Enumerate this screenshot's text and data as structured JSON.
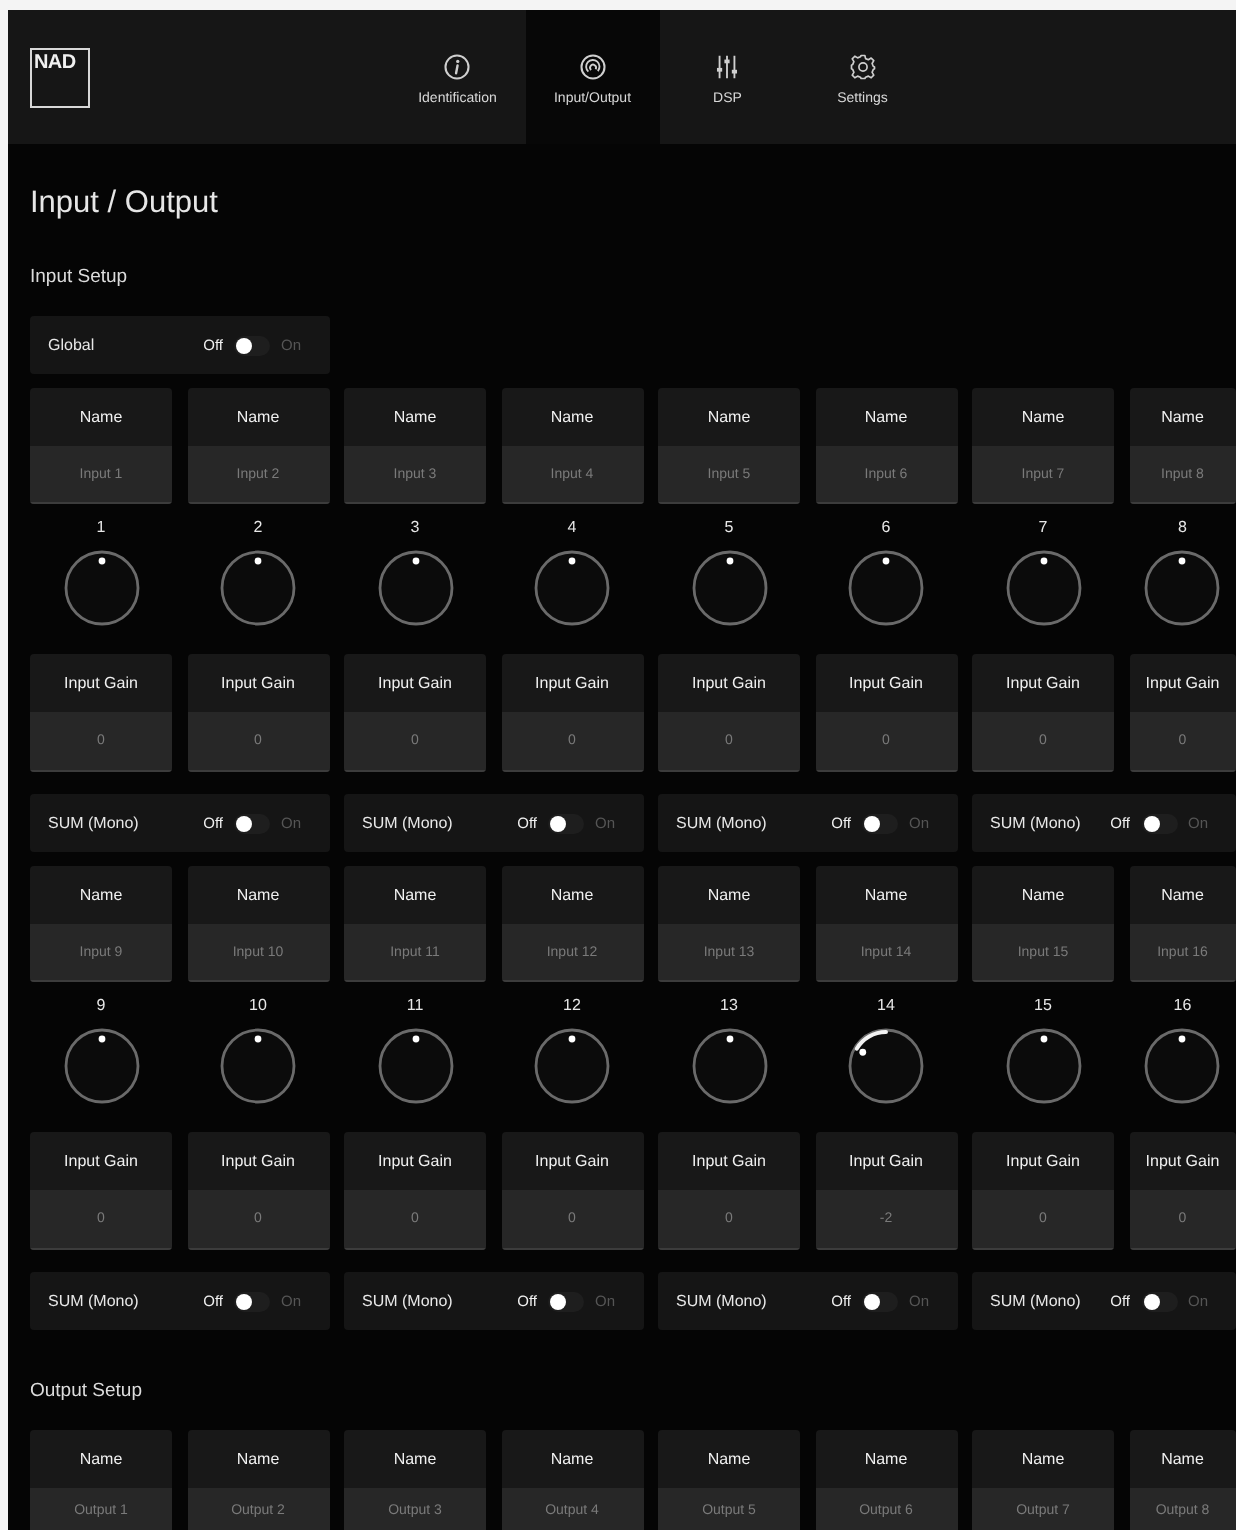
{
  "header": {
    "logo": "NAD",
    "tabs": [
      {
        "label": "Identification",
        "selected": false
      },
      {
        "label": "Input/Output",
        "selected": true
      },
      {
        "label": "DSP",
        "selected": false
      },
      {
        "label": "Settings",
        "selected": false
      }
    ]
  },
  "page": {
    "title": "Input / Output"
  },
  "input_setup": {
    "heading": "Input Setup",
    "global": {
      "label": "Global",
      "off_label": "Off",
      "on_label": "On",
      "on": false
    },
    "blocks": [
      {
        "channels": [
          {
            "name_label": "Name",
            "name_value": "Input 1",
            "number": "1",
            "level": 0.5,
            "gain_label": "Input Gain",
            "gain_value": "0"
          },
          {
            "name_label": "Name",
            "name_value": "Input 2",
            "number": "2",
            "level": 0.5,
            "gain_label": "Input Gain",
            "gain_value": "0"
          },
          {
            "name_label": "Name",
            "name_value": "Input 3",
            "number": "3",
            "level": 0.5,
            "gain_label": "Input Gain",
            "gain_value": "0"
          },
          {
            "name_label": "Name",
            "name_value": "Input 4",
            "number": "4",
            "level": 0.5,
            "gain_label": "Input Gain",
            "gain_value": "0"
          },
          {
            "name_label": "Name",
            "name_value": "Input 5",
            "number": "5",
            "level": 0.5,
            "gain_label": "Input Gain",
            "gain_value": "0"
          },
          {
            "name_label": "Name",
            "name_value": "Input 6",
            "number": "6",
            "level": 0.5,
            "gain_label": "Input Gain",
            "gain_value": "0"
          },
          {
            "name_label": "Name",
            "name_value": "Input 7",
            "number": "7",
            "level": 0.5,
            "gain_label": "Input Gain",
            "gain_value": "0"
          },
          {
            "name_label": "Name",
            "name_value": "Input 8",
            "number": "8",
            "level": 0.5,
            "gain_label": "Input Gain",
            "gain_value": "0"
          }
        ],
        "sums": [
          {
            "label": "SUM (Mono)",
            "off_label": "Off",
            "on_label": "On",
            "on": false
          },
          {
            "label": "SUM (Mono)",
            "off_label": "Off",
            "on_label": "On",
            "on": false
          },
          {
            "label": "SUM (Mono)",
            "off_label": "Off",
            "on_label": "On",
            "on": false
          },
          {
            "label": "SUM (Mono)",
            "off_label": "Off",
            "on_label": "On",
            "on": false
          }
        ]
      },
      {
        "channels": [
          {
            "name_label": "Name",
            "name_value": "Input 9",
            "number": "9",
            "level": 0.5,
            "gain_label": "Input Gain",
            "gain_value": "0"
          },
          {
            "name_label": "Name",
            "name_value": "Input 10",
            "number": "10",
            "level": 0.5,
            "gain_label": "Input Gain",
            "gain_value": "0"
          },
          {
            "name_label": "Name",
            "name_value": "Input 11",
            "number": "11",
            "level": 0.5,
            "gain_label": "Input Gain",
            "gain_value": "0"
          },
          {
            "name_label": "Name",
            "name_value": "Input 12",
            "number": "12",
            "level": 0.5,
            "gain_label": "Input Gain",
            "gain_value": "0"
          },
          {
            "name_label": "Name",
            "name_value": "Input 13",
            "number": "13",
            "level": 0.5,
            "gain_label": "Input Gain",
            "gain_value": "0"
          },
          {
            "name_label": "Name",
            "name_value": "Input 14",
            "number": "14",
            "level": 0.28,
            "gain_label": "Input Gain",
            "gain_value": "-2"
          },
          {
            "name_label": "Name",
            "name_value": "Input 15",
            "number": "15",
            "level": 0.5,
            "gain_label": "Input Gain",
            "gain_value": "0"
          },
          {
            "name_label": "Name",
            "name_value": "Input 16",
            "number": "16",
            "level": 0.5,
            "gain_label": "Input Gain",
            "gain_value": "0"
          }
        ],
        "sums": [
          {
            "label": "SUM (Mono)",
            "off_label": "Off",
            "on_label": "On",
            "on": false
          },
          {
            "label": "SUM (Mono)",
            "off_label": "Off",
            "on_label": "On",
            "on": false
          },
          {
            "label": "SUM (Mono)",
            "off_label": "Off",
            "on_label": "On",
            "on": false
          },
          {
            "label": "SUM (Mono)",
            "off_label": "Off",
            "on_label": "On",
            "on": false
          }
        ]
      }
    ]
  },
  "output_setup": {
    "heading": "Output Setup",
    "channels": [
      {
        "name_label": "Name",
        "name_value": "Output 1"
      },
      {
        "name_label": "Name",
        "name_value": "Output 2"
      },
      {
        "name_label": "Name",
        "name_value": "Output 3"
      },
      {
        "name_label": "Name",
        "name_value": "Output 4"
      },
      {
        "name_label": "Name",
        "name_value": "Output 5"
      },
      {
        "name_label": "Name",
        "name_value": "Output 6"
      },
      {
        "name_label": "Name",
        "name_value": "Output 7"
      },
      {
        "name_label": "Name",
        "name_value": "Output 8"
      }
    ]
  }
}
